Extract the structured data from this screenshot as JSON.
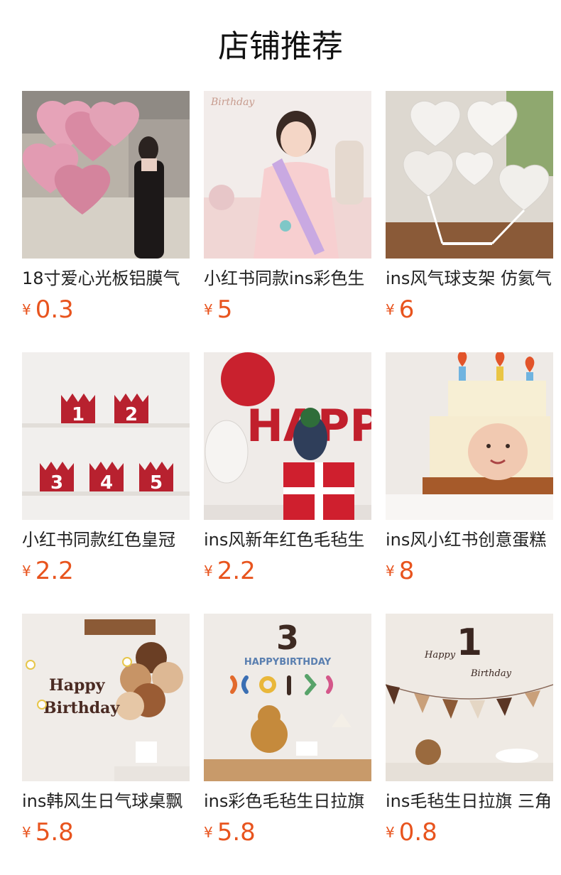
{
  "section_title": "店铺推荐",
  "currency_symbol": "¥",
  "accent_color": "#e8541e",
  "products": [
    {
      "name": "18寸爱心光板铝膜气",
      "price": "0.3"
    },
    {
      "name": "小红书同款ins彩色生",
      "price": "5"
    },
    {
      "name": "ins风气球支架 仿氦气",
      "price": "6"
    },
    {
      "name": "小红书同款红色皇冠",
      "price": "2.2"
    },
    {
      "name": "ins风新年红色毛毡生",
      "price": "2.2"
    },
    {
      "name": "ins风小红书创意蛋糕",
      "price": "8"
    },
    {
      "name": "ins韩风生日气球桌飘",
      "price": "5.8"
    },
    {
      "name": "ins彩色毛毡生日拉旗",
      "price": "5.8"
    },
    {
      "name": "ins毛毡生日拉旗 三角",
      "price": "0.8"
    }
  ],
  "images": [
    {
      "name": "product-image-pink-heart-balloons",
      "photo_text": ""
    },
    {
      "name": "product-image-girl-birthday-sash",
      "photo_text": "Birthday"
    },
    {
      "name": "product-image-clear-heart-balloons",
      "photo_text": ""
    },
    {
      "name": "product-image-felt-number-crowns",
      "photo_text": "1 2 3 4 5"
    },
    {
      "name": "product-image-red-felt-banner",
      "photo_text": "HAPPY"
    },
    {
      "name": "product-image-cake-hat",
      "photo_text": ""
    },
    {
      "name": "product-image-happy-birthday-balloons",
      "photo_text": "Happy Birthday"
    },
    {
      "name": "product-image-colorful-felt-banner",
      "photo_text": "3 HAPPY BIRTHDAY"
    },
    {
      "name": "product-image-pennant-banner",
      "photo_text": "1 Happy Birthday"
    }
  ]
}
